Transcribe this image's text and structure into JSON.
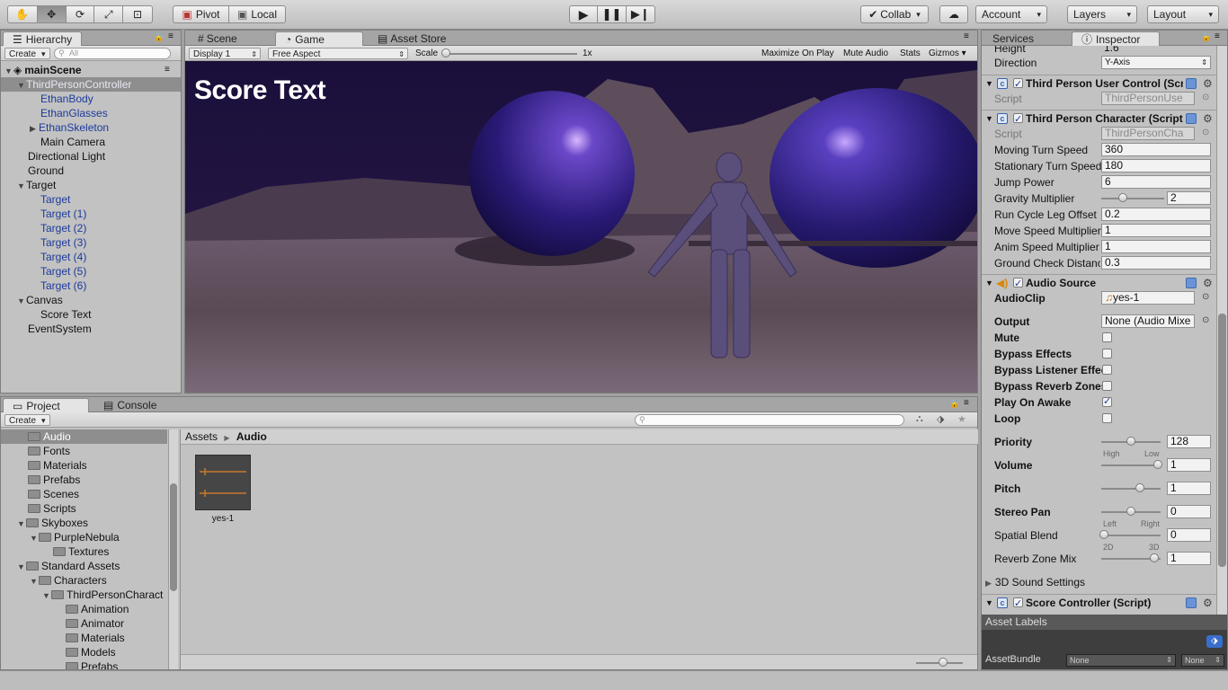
{
  "toolbar": {
    "tools": [
      "hand-icon",
      "move-icon",
      "rotate-icon",
      "scale-icon",
      "rect-tool-icon"
    ],
    "pivot_label": "Pivot",
    "local_label": "Local",
    "collab_label": "Collab",
    "account_label": "Account",
    "layers_label": "Layers",
    "layout_label": "Layout"
  },
  "hierarchy": {
    "tab_label": "Hierarchy",
    "create_label": "Create",
    "search_placeholder": "All",
    "scene_name": "mainScene",
    "items": [
      {
        "label": "ThirdPersonController"
      },
      {
        "label": "EthanBody"
      },
      {
        "label": "EthanGlasses"
      },
      {
        "label": "EthanSkeleton"
      },
      {
        "label": "Main Camera"
      },
      {
        "label": "Directional Light"
      },
      {
        "label": "Ground"
      },
      {
        "label": "Target"
      },
      {
        "label": "Target"
      },
      {
        "label": "Target (1)"
      },
      {
        "label": "Target (2)"
      },
      {
        "label": "Target (3)"
      },
      {
        "label": "Target (4)"
      },
      {
        "label": "Target (5)"
      },
      {
        "label": "Target (6)"
      },
      {
        "label": "Canvas"
      },
      {
        "label": "Score Text"
      },
      {
        "label": "EventSystem"
      }
    ]
  },
  "game": {
    "tabs": [
      "Scene",
      "Game",
      "Asset Store"
    ],
    "display": "Display 1",
    "aspect": "Free Aspect",
    "scale_label": "Scale",
    "scale_value": "1x",
    "maximize_label": "Maximize On Play",
    "mute_label": "Mute Audio",
    "stats_label": "Stats",
    "gizmos_label": "Gizmos",
    "score_text": "Score Text"
  },
  "project": {
    "tabs": [
      "Project",
      "Console"
    ],
    "create_label": "Create",
    "breadcrumb": [
      "Assets",
      "Audio"
    ],
    "tree": [
      {
        "label": "Audio"
      },
      {
        "label": "Fonts"
      },
      {
        "label": "Materials"
      },
      {
        "label": "Prefabs"
      },
      {
        "label": "Scenes"
      },
      {
        "label": "Scripts"
      },
      {
        "label": "Skyboxes"
      },
      {
        "label": "PurpleNebula"
      },
      {
        "label": "Textures"
      },
      {
        "label": "Standard Assets"
      },
      {
        "label": "Characters"
      },
      {
        "label": "ThirdPersonCharact"
      },
      {
        "label": "Animation"
      },
      {
        "label": "Animator"
      },
      {
        "label": "Materials"
      },
      {
        "label": "Models"
      },
      {
        "label": "Prefabs"
      }
    ],
    "asset_name": "yes-1"
  },
  "inspector": {
    "tabs": [
      "Services",
      "Inspector"
    ],
    "height_label": "Height",
    "height_value": "1.6",
    "direction_label": "Direction",
    "direction_value": "Y-Axis",
    "user_control": {
      "title": "Third Person User Control (Scr",
      "script_label": "Script",
      "script_value": "ThirdPersonUse"
    },
    "character": {
      "title": "Third Person Character (Script)",
      "script_label": "Script",
      "script_value": "ThirdPersonCha",
      "fields": [
        {
          "label": "Moving Turn Speed",
          "value": "360"
        },
        {
          "label": "Stationary Turn Speed",
          "value": "180"
        },
        {
          "label": "Jump Power",
          "value": "6"
        },
        {
          "label": "Gravity Multiplier",
          "value": "2"
        },
        {
          "label": "Run Cycle Leg Offset",
          "value": "0.2"
        },
        {
          "label": "Move Speed Multiplier",
          "value": "1"
        },
        {
          "label": "Anim Speed Multiplier",
          "value": "1"
        },
        {
          "label": "Ground Check Distanc",
          "value": "0.3"
        }
      ]
    },
    "audio": {
      "title": "Audio Source",
      "clip_label": "AudioClip",
      "clip_value": "yes-1",
      "output_label": "Output",
      "output_value": "None (Audio Mixe",
      "checks": [
        {
          "label": "Mute",
          "on": false
        },
        {
          "label": "Bypass Effects",
          "on": false
        },
        {
          "label": "Bypass Listener Effec",
          "on": false
        },
        {
          "label": "Bypass Reverb Zones",
          "on": false
        },
        {
          "label": "Play On Awake",
          "on": true
        },
        {
          "label": "Loop",
          "on": false
        }
      ],
      "priority_label": "Priority",
      "priority_value": "128",
      "priority_high": "High",
      "priority_low": "Low",
      "volume_label": "Volume",
      "volume_value": "1",
      "pitch_label": "Pitch",
      "pitch_value": "1",
      "pan_label": "Stereo Pan",
      "pan_value": "0",
      "pan_left": "Left",
      "pan_right": "Right",
      "blend_label": "Spatial Blend",
      "blend_value": "0",
      "blend_2d": "2D",
      "blend_3d": "3D",
      "reverb_label": "Reverb Zone Mix",
      "reverb_value": "1",
      "sound3d_label": "3D Sound Settings"
    },
    "score_controller": {
      "title": "Score Controller (Script)"
    },
    "asset_labels": "Asset Labels",
    "assetbundle_label": "AssetBundle",
    "assetbundle_value": "None",
    "assetbundle_variant": "None"
  }
}
